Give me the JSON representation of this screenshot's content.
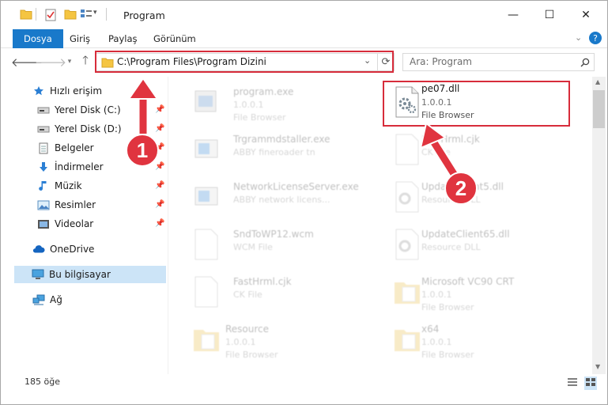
{
  "window": {
    "title": "Program",
    "minimize": "—",
    "maximize": "☐",
    "close": "✕"
  },
  "ribbon": {
    "tabs": [
      "Dosya",
      "Giriş",
      "Paylaş",
      "Görünüm"
    ],
    "help": "?"
  },
  "address": {
    "path": "C:\\Program Files\\Program Dizini",
    "search_placeholder": "Ara: Program"
  },
  "nav": {
    "items": [
      {
        "label": "Hızlı erişim",
        "icon": "star-icon"
      },
      {
        "label": "Yerel Disk (C:)",
        "icon": "drive-icon"
      },
      {
        "label": "Yerel Disk (D:)",
        "icon": "drive-icon"
      },
      {
        "label": "Belgeler",
        "icon": "documents-icon"
      },
      {
        "label": "İndirmeler",
        "icon": "download-icon"
      },
      {
        "label": "Müzik",
        "icon": "music-icon"
      },
      {
        "label": "Resimler",
        "icon": "pictures-icon"
      },
      {
        "label": "Videolar",
        "icon": "videos-icon"
      },
      {
        "label": "OneDrive",
        "icon": "cloud-icon"
      },
      {
        "label": "Bu bilgisayar",
        "icon": "computer-icon"
      },
      {
        "label": "Ağ",
        "icon": "network-icon"
      }
    ]
  },
  "files": [
    {
      "name": "program.exe",
      "sub": "1.0.0.1",
      "sub2": "File Browser"
    },
    {
      "name": "pe07.dll",
      "sub": "1.0.0.1",
      "sub2": "File Browser"
    },
    {
      "name": "Trgrammdstaller.exe",
      "sub": "ABBY fineroader tn"
    },
    {
      "name": "FineHrml.cjk",
      "sub": "CK File"
    },
    {
      "name": "NetworkLicenseServer.exe",
      "sub": "ABBY network licens..."
    },
    {
      "name": "UpdateClient5.dll",
      "sub": "Resource DLL"
    },
    {
      "name": "SndToWP12.wcm",
      "sub": "WCM File"
    },
    {
      "name": "UpdateClient65.dll",
      "sub": "Resource DLL"
    },
    {
      "name": "FastHrml.cjk",
      "sub": "CK File"
    },
    {
      "name": "Microsoft VC90 CRT",
      "sub": "1.0.0.1",
      "sub2": "File Browser"
    },
    {
      "name": "Resource",
      "sub": "1.0.0.1",
      "sub2": "File Browser"
    },
    {
      "name": "x64",
      "sub": "1.0.0.1",
      "sub2": "File Browser"
    }
  ],
  "status": {
    "count": "185 öğe"
  },
  "annotations": {
    "step1": "1",
    "step2": "2"
  },
  "colors": {
    "accent": "#1979ca",
    "highlight": "#d72c3b",
    "selection": "#cce4f7"
  }
}
